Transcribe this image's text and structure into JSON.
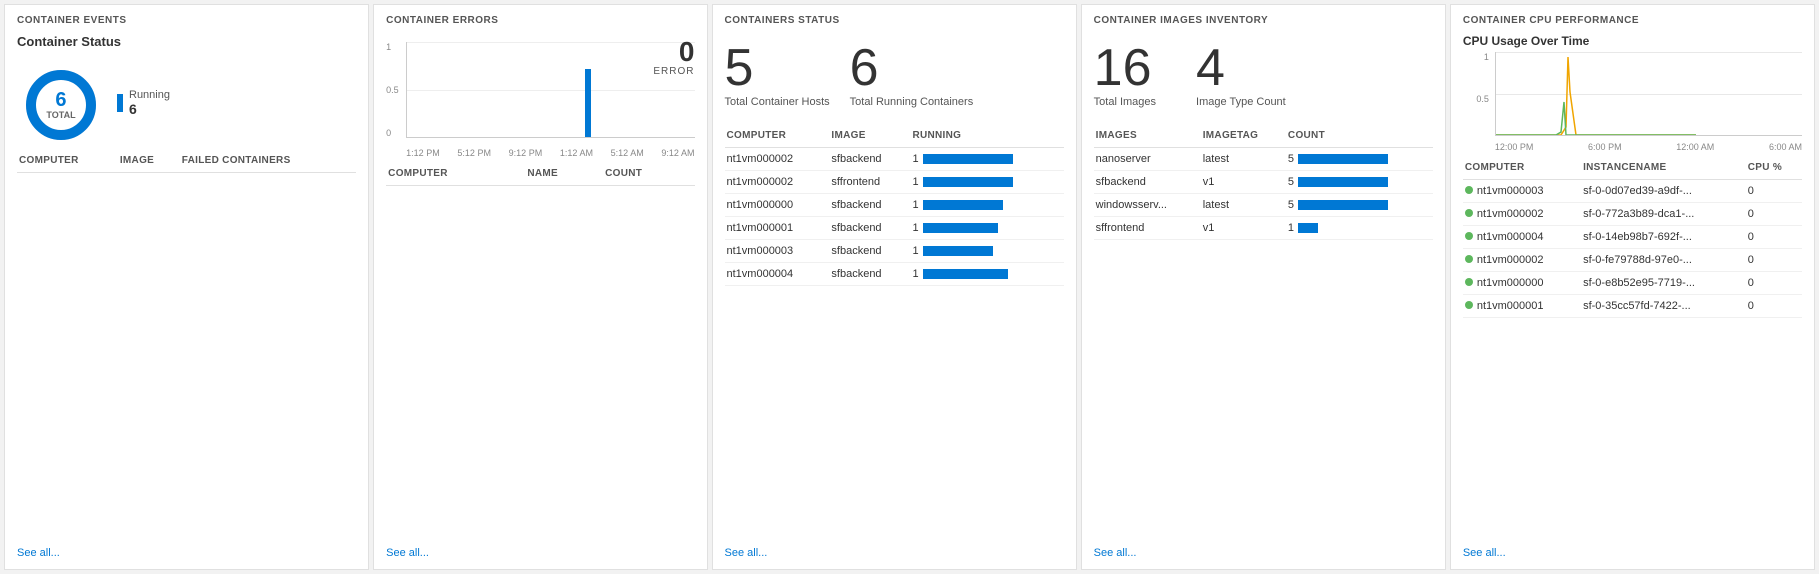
{
  "panels": {
    "events": {
      "title": "CONTAINER EVENTS",
      "subtitle": "Container Status",
      "donut": {
        "total": "6",
        "total_label": "TOTAL",
        "running_label": "Running",
        "running_value": "6"
      },
      "table": {
        "columns": [
          "COMPUTER",
          "IMAGE",
          "FAILED CONTAINERS"
        ],
        "rows": []
      },
      "see_all": "See all..."
    },
    "errors": {
      "title": "CONTAINER ERRORS",
      "error_count": "0",
      "error_label": "ERROR",
      "y_labels": [
        "1",
        "0.5",
        "0"
      ],
      "x_labels": [
        "1:12 PM",
        "5:12 PM",
        "9:12 PM",
        "1:12 AM",
        "5:12 AM",
        "9:12 AM"
      ],
      "table": {
        "columns": [
          "COMPUTER",
          "NAME",
          "COUNT"
        ],
        "rows": []
      },
      "see_all": "See all..."
    },
    "status": {
      "title": "CONTAINERS STATUS",
      "metrics": [
        {
          "value": "5",
          "label": "Total Container Hosts"
        },
        {
          "value": "6",
          "label": "Total Running Containers"
        }
      ],
      "table": {
        "columns": [
          "COMPUTER",
          "IMAGE",
          "RUNNING"
        ],
        "rows": [
          {
            "computer": "nt1vm000002",
            "image": "sfbackend",
            "running": "1",
            "bar": 90
          },
          {
            "computer": "nt1vm000002",
            "image": "sffrontend",
            "running": "1",
            "bar": 90
          },
          {
            "computer": "nt1vm000000",
            "image": "sfbackend",
            "running": "1",
            "bar": 80
          },
          {
            "computer": "nt1vm000001",
            "image": "sfbackend",
            "running": "1",
            "bar": 75
          },
          {
            "computer": "nt1vm000003",
            "image": "sfbackend",
            "running": "1",
            "bar": 70
          },
          {
            "computer": "nt1vm000004",
            "image": "sfbackend",
            "running": "1",
            "bar": 85
          }
        ]
      },
      "see_all": "See all..."
    },
    "images": {
      "title": "CONTAINER IMAGES INVENTORY",
      "metrics": [
        {
          "value": "16",
          "label": "Total Images"
        },
        {
          "value": "4",
          "label": "Image Type Count"
        }
      ],
      "table": {
        "columns": [
          "IMAGES",
          "IMAGETAG",
          "COUNT"
        ],
        "rows": [
          {
            "image": "nanoserver",
            "tag": "latest",
            "count": "5",
            "bar": 90
          },
          {
            "image": "sfbackend",
            "tag": "v1",
            "count": "5",
            "bar": 90
          },
          {
            "image": "windowsserv...",
            "tag": "latest",
            "count": "5",
            "bar": 90
          },
          {
            "image": "sffrontend",
            "tag": "v1",
            "count": "1",
            "bar": 20
          }
        ]
      },
      "see_all": "See all..."
    },
    "cpu": {
      "title": "CONTAINER CPU PERFORMANCE",
      "chart_title": "CPU Usage Over Time",
      "y_labels": [
        "1",
        "0.5"
      ],
      "x_labels": [
        "12:00 PM",
        "6:00 PM",
        "12:00 AM",
        "6:00 AM"
      ],
      "table": {
        "columns": [
          "COMPUTER",
          "INSTANCENAME",
          "CPU %"
        ],
        "rows": [
          {
            "computer": "nt1vm000003",
            "instance": "sf-0-0d07ed39-a9df-...",
            "cpu": "0"
          },
          {
            "computer": "nt1vm000002",
            "instance": "sf-0-772a3b89-dca1-...",
            "cpu": "0"
          },
          {
            "computer": "nt1vm000004",
            "instance": "sf-0-14eb98b7-692f-...",
            "cpu": "0"
          },
          {
            "computer": "nt1vm000002",
            "instance": "sf-0-fe79788d-97e0-...",
            "cpu": "0"
          },
          {
            "computer": "nt1vm000000",
            "instance": "sf-0-e8b52e95-7719-...",
            "cpu": "0"
          },
          {
            "computer": "nt1vm000001",
            "instance": "sf-0-35cc57fd-7422-...",
            "cpu": "0"
          }
        ]
      },
      "see_all": "See all..."
    }
  }
}
